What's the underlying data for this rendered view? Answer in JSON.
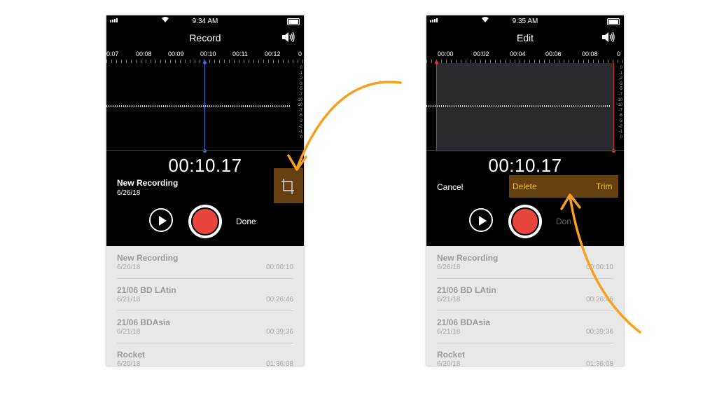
{
  "left_screen": {
    "status": {
      "time": "9:34 AM"
    },
    "title": "Record",
    "ruler_labels": [
      "0:07",
      "00:08",
      "00:09",
      "00:10",
      "00:11",
      "00:12",
      "0"
    ],
    "db_scale": [
      "0",
      "-1",
      "-2",
      "-3",
      "-5",
      "-7",
      "-10",
      "-10",
      "-7",
      "-5",
      "-3",
      "-2",
      "-1",
      "0"
    ],
    "timer": "00:10.17",
    "recording_name": "New Recording",
    "recording_date": "6/26/18",
    "done_label": "Done",
    "icons": {
      "speaker": "speaker-icon",
      "play": "play-icon",
      "record": "record-icon",
      "trim": "crop-icon"
    }
  },
  "right_screen": {
    "status": {
      "time": "9:35 AM"
    },
    "title": "Edit",
    "ruler_labels": [
      "00:00",
      "00:02",
      "00:04",
      "00:06",
      "00:08",
      "0"
    ],
    "db_scale": [
      "0",
      "-1",
      "-2",
      "-3",
      "-5",
      "-7",
      "-10",
      "-10",
      "-7",
      "-5",
      "-3",
      "-2",
      "-1",
      "0"
    ],
    "timer": "00:10.17",
    "cancel_label": "Cancel",
    "delete_label": "Delete",
    "trim_label": "Trim",
    "done_label": "Don"
  },
  "recordings": [
    {
      "name": "New Recording",
      "date": "6/26/18",
      "duration": "00:00:10"
    },
    {
      "name": "21/06 BD LAtin",
      "date": "6/21/18",
      "duration": "00:26:46"
    },
    {
      "name": "21/06 BDAsia",
      "date": "6/21/18",
      "duration": "00:39:36"
    },
    {
      "name": "Rocket",
      "date": "6/20/18",
      "duration": "01:36:08"
    }
  ],
  "colors": {
    "record_red": "#e8453c",
    "annotation_orange": "#f5a020",
    "highlight_brown": "#7a4a14"
  }
}
